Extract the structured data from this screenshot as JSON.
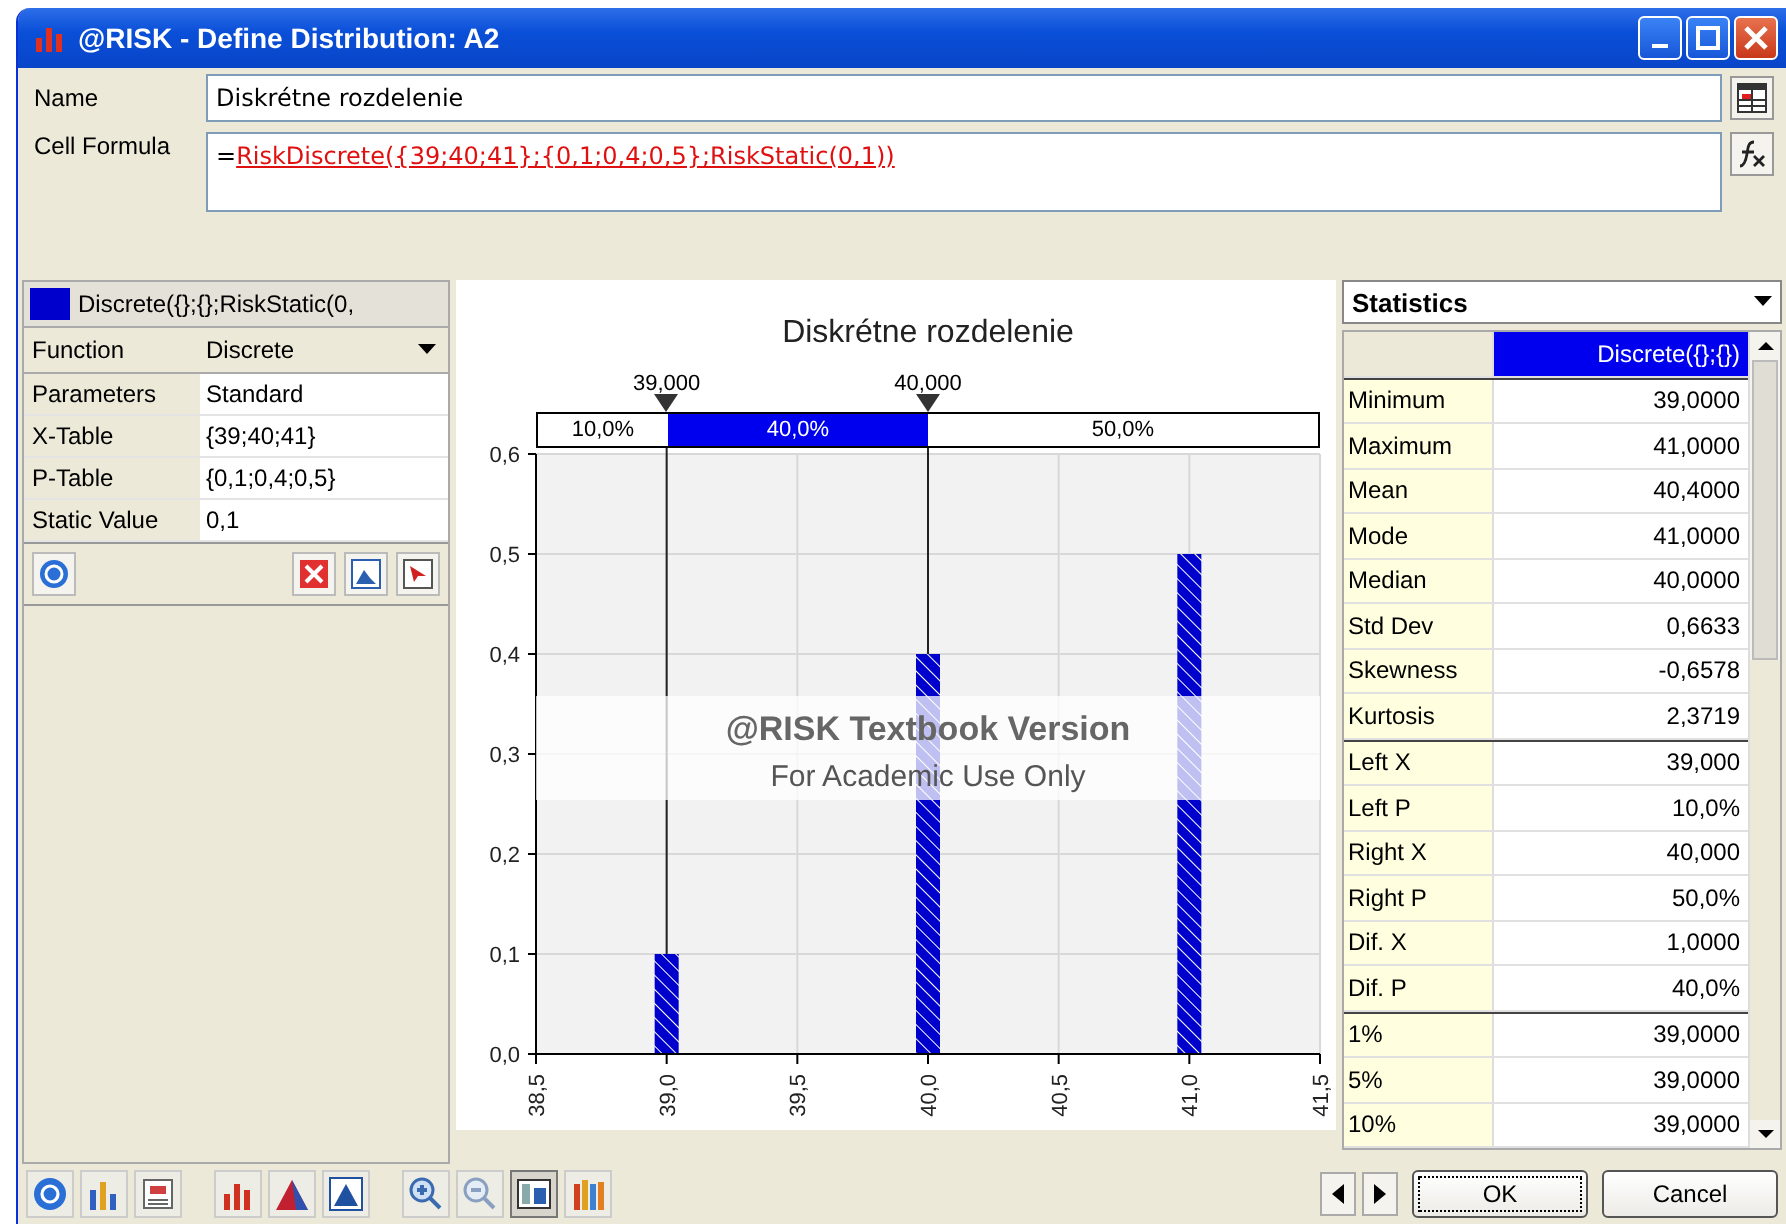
{
  "window": {
    "title": "@RISK - Define Distribution: A2"
  },
  "name_field": {
    "label": "Name",
    "value": "Diskrétne rozdelenie"
  },
  "formula_field": {
    "label": "Cell Formula",
    "prefix": "=",
    "formula": "RiskDiscrete({39;40;41};{0,1;0,4;0,5};RiskStatic(0,1))"
  },
  "parameters": {
    "header": "Discrete({};{};RiskStatic(0,",
    "color": "#0000cc",
    "rows": [
      {
        "kind": "dropdown",
        "label": "Function",
        "value": "Discrete"
      },
      {
        "kind": "text",
        "label": "Parameters",
        "value": "Standard"
      },
      {
        "kind": "text",
        "label": "X-Table",
        "value": "{39;40;41}"
      },
      {
        "kind": "text",
        "label": "P-Table",
        "value": "{0,1;0,4;0,5}"
      },
      {
        "kind": "text",
        "label": "Static Value",
        "value": "0,1"
      }
    ]
  },
  "chart": {
    "probability_strip": [
      {
        "label": "10,0%",
        "selected": false
      },
      {
        "label": "40,0%",
        "selected": true
      },
      {
        "label": "50,0%",
        "selected": false
      }
    ],
    "overlay_text": [
      "@RISK Textbook Version",
      "For Academic Use Only"
    ],
    "chart_data": {
      "type": "bar",
      "title": "Diskrétne rozdelenie",
      "x": [
        39,
        40,
        41
      ],
      "grid": true,
      "series": [
        {
          "color": "#0000cc",
          "values": [
            0.1,
            0.4,
            0.5
          ]
        }
      ],
      "ref_lines": [
        {
          "axis": "x",
          "value": 39,
          "label": "39,000"
        },
        {
          "axis": "x",
          "value": 40,
          "label": "40,000"
        }
      ],
      "xlim": [
        38.5,
        41.5
      ],
      "ylim": [
        0,
        0.6
      ],
      "xticks": [
        {
          "value": 38.5,
          "label": "38,5"
        },
        {
          "value": 39,
          "label": "39,0"
        },
        {
          "value": 39.5,
          "label": "39,5"
        },
        {
          "value": 40,
          "label": "40,0"
        },
        {
          "value": 40.5,
          "label": "40,5"
        },
        {
          "value": 41,
          "label": "41,0"
        },
        {
          "value": 41.5,
          "label": "41,5"
        }
      ],
      "yticks": [
        {
          "value": 0,
          "label": "0,0"
        },
        {
          "value": 0.1,
          "label": "0,1"
        },
        {
          "value": 0.2,
          "label": "0,2"
        },
        {
          "value": 0.3,
          "label": "0,3"
        },
        {
          "value": 0.4,
          "label": "0,4"
        },
        {
          "value": 0.5,
          "label": "0,5"
        },
        {
          "value": 0.6,
          "label": "0,6"
        }
      ]
    }
  },
  "statistics": {
    "selector": "Statistics",
    "column": "Discrete({};{})",
    "sections": [
      [
        {
          "label": "Minimum",
          "value": "39,0000"
        },
        {
          "label": "Maximum",
          "value": "41,0000"
        },
        {
          "label": "Mean",
          "value": "40,4000"
        },
        {
          "label": "Mode",
          "value": "41,0000"
        },
        {
          "label": "Median",
          "value": "40,0000"
        },
        {
          "label": "Std Dev",
          "value": "0,6633"
        },
        {
          "label": "Skewness",
          "value": "-0,6578"
        },
        {
          "label": "Kurtosis",
          "value": "2,3719"
        }
      ],
      [
        {
          "label": "Left X",
          "value": "39,000"
        },
        {
          "label": "Left P",
          "value": "10,0%"
        },
        {
          "label": "Right X",
          "value": "40,000"
        },
        {
          "label": "Right P",
          "value": "50,0%"
        },
        {
          "label": "Dif. X",
          "value": "1,0000"
        },
        {
          "label": "Dif. P",
          "value": "40,0%"
        }
      ],
      [
        {
          "label": "1%",
          "value": "39,0000"
        },
        {
          "label": "5%",
          "value": "39,0000"
        },
        {
          "label": "10%",
          "value": "39,0000"
        }
      ]
    ]
  },
  "buttons": [
    "OK",
    "Cancel"
  ]
}
